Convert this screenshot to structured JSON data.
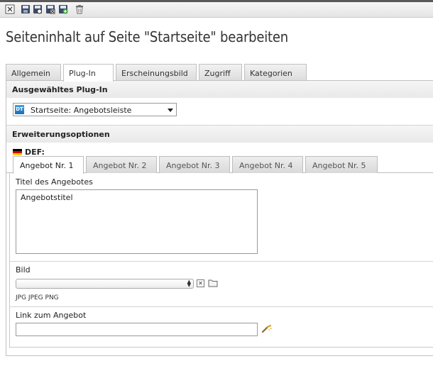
{
  "toolbar": {
    "icons": [
      "close-icon",
      "save-icon",
      "save-view-icon",
      "save-close-icon",
      "save-new-icon",
      "delete-icon"
    ]
  },
  "page": {
    "title": "Seiteninhalt auf Seite \"Startseite\" bearbeiten"
  },
  "main_tabs": [
    {
      "label": "Allgemein",
      "active": false
    },
    {
      "label": "Plug-In",
      "active": true
    },
    {
      "label": "Erscheinungsbild",
      "active": false
    },
    {
      "label": "Zugriff",
      "active": false
    },
    {
      "label": "Kategorien",
      "active": false
    }
  ],
  "plugin_section": {
    "heading": "Ausgewähltes Plug-In",
    "select_icon_text": "DT",
    "selected_value": "Startseite: Angebotsleiste"
  },
  "extension_section": {
    "heading": "Erweiterungsoptionen",
    "language_label": "DEF:",
    "sub_tabs": [
      {
        "label": "Angebot Nr. 1",
        "active": true
      },
      {
        "label": "Angebot Nr. 2",
        "active": false
      },
      {
        "label": "Angebot Nr. 3",
        "active": false
      },
      {
        "label": "Angebot Nr. 4",
        "active": false
      },
      {
        "label": "Angebot Nr. 5",
        "active": false
      }
    ],
    "fields": {
      "title_label": "Titel des Angebotes",
      "title_value": "Angebotstitel",
      "image_label": "Bild",
      "image_value": "",
      "image_types": "JPG JPEG PNG",
      "link_label": "Link zum Angebot",
      "link_value": ""
    }
  },
  "colors": {
    "accent_blue": "#1a6cb8",
    "flag_black": "#000000",
    "flag_red": "#dd0000",
    "flag_gold": "#ffce00"
  }
}
